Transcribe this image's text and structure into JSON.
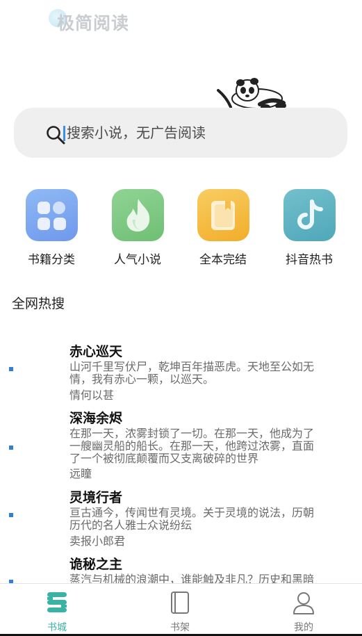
{
  "app": {
    "logo_text": "极简阅读"
  },
  "search": {
    "placeholder": "搜索小说，无广告阅读"
  },
  "categories": [
    {
      "label": "书籍分类",
      "icon": "grid-icon",
      "color": "#7aa9f0"
    },
    {
      "label": "人气小说",
      "icon": "flame-icon",
      "color": "#7fcb84"
    },
    {
      "label": "全本完结",
      "icon": "book-icon",
      "color": "#f6bd3c"
    },
    {
      "label": "抖音热书",
      "icon": "tiktok-icon",
      "color": "#5fb6c4"
    }
  ],
  "hot": {
    "title": "全网热搜",
    "books": [
      {
        "title": "赤心巡天",
        "desc_lines": [
          "山河千里写伏尸，乾坤百年描恶虎。天地至公如无",
          "情，我有赤心一颗，以巡天。"
        ],
        "author": "情何以甚"
      },
      {
        "title": "深海余烬",
        "desc_lines": [
          "在那一天，浓雾封锁了一切。在那一天，他成为了",
          "一艘幽灵船的船长。在那一天，他跨过浓雾，直面",
          "了一个被彻底颠覆而又支离破碎的世界"
        ],
        "author": "远瞳"
      },
      {
        "title": "灵境行者",
        "desc_lines": [
          "亘古通今，传闻世有灵境。关于灵境的说法，历朝",
          "历代的名人雅士众说纷纭"
        ],
        "author": "卖报小郎君"
      },
      {
        "title": "诡秘之主",
        "desc_lines": [
          "蒸汽与机械的浪潮中，谁能触及非凡？历史和黑暗"
        ],
        "author": ""
      }
    ]
  },
  "tabs": [
    {
      "label": "书城",
      "icon": "bookstore-icon",
      "active": true
    },
    {
      "label": "书架",
      "icon": "bookshelf-icon",
      "active": false
    },
    {
      "label": "我的",
      "icon": "profile-icon",
      "active": false
    }
  ],
  "colors": {
    "accent": "#39b3a4",
    "list_marker": "#2f7fe0"
  }
}
